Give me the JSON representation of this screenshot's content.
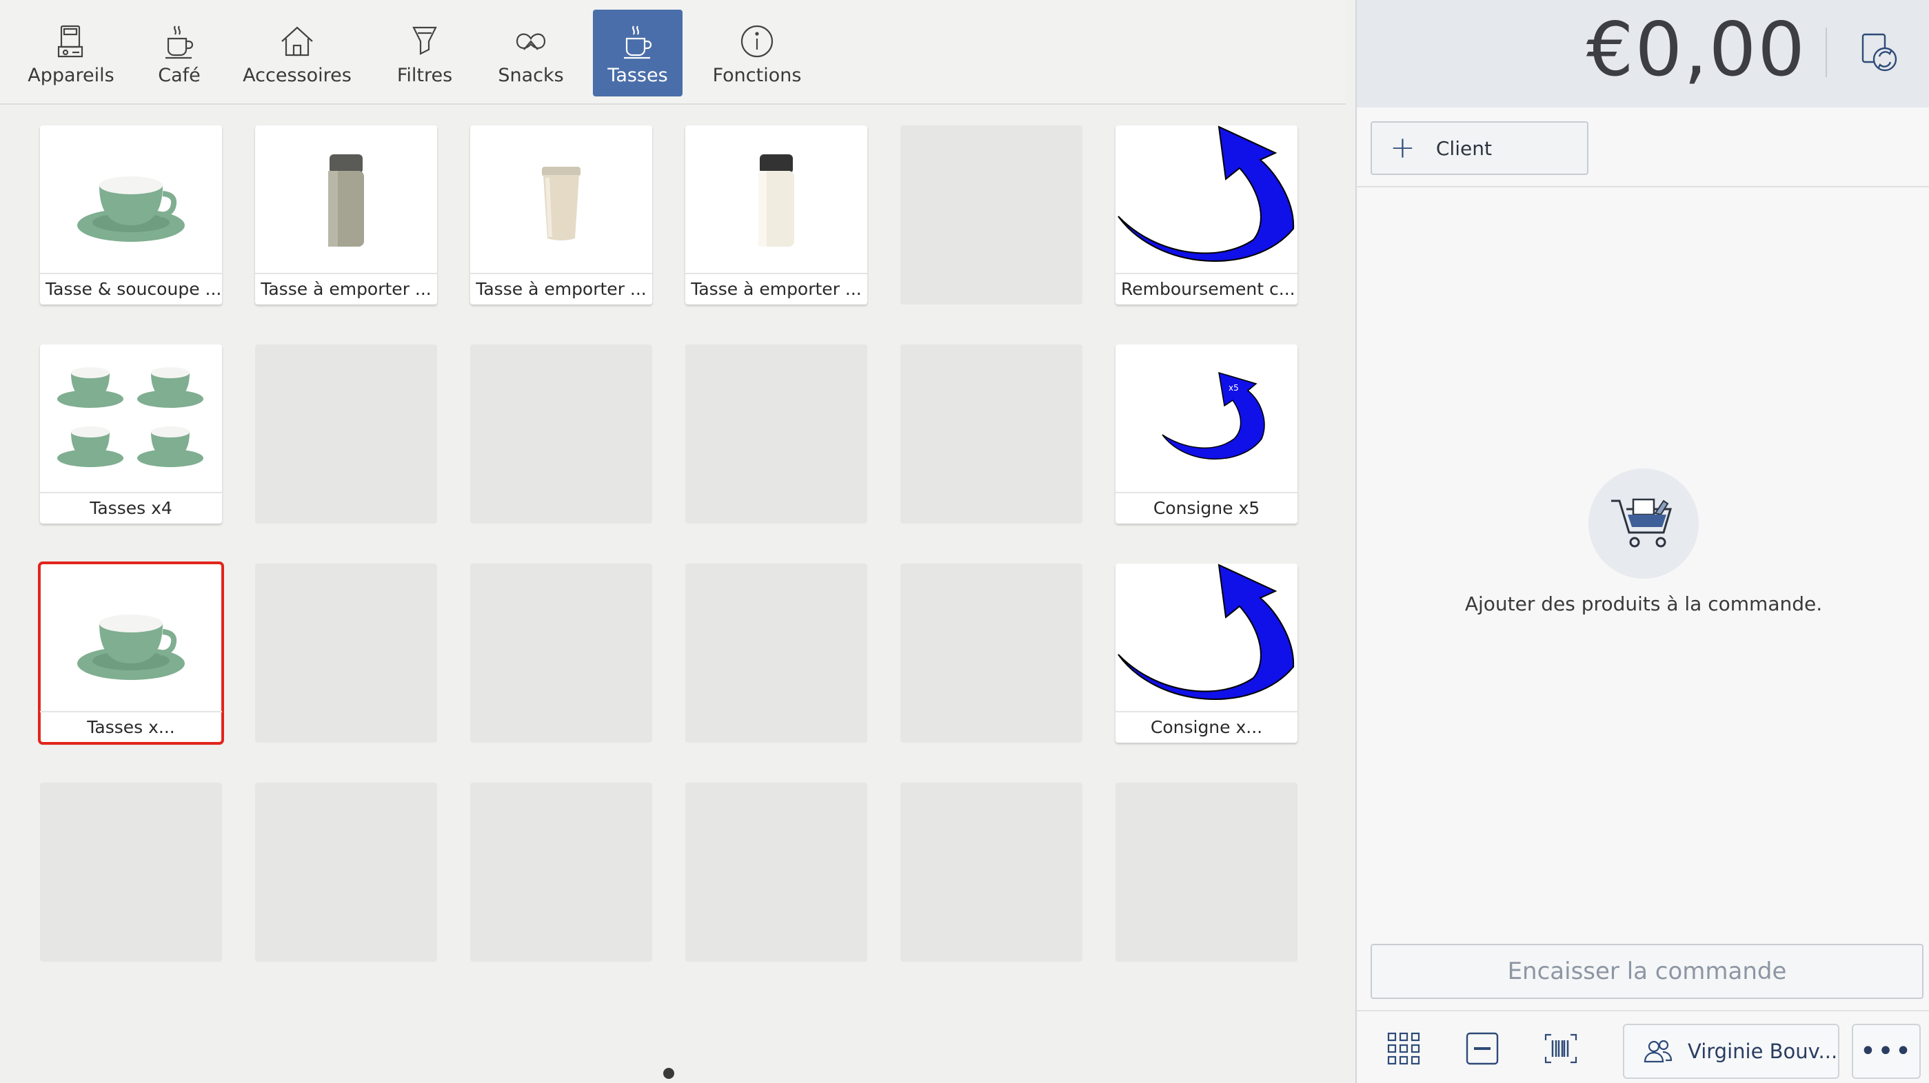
{
  "tabs": [
    {
      "label": "Appareils",
      "icon": "device-icon"
    },
    {
      "label": "Café",
      "icon": "coffee-cup-icon"
    },
    {
      "label": "Accessoires",
      "icon": "house-icon"
    },
    {
      "label": "Filtres",
      "icon": "filter-icon"
    },
    {
      "label": "Snacks",
      "icon": "pretzel-icon"
    },
    {
      "label": "Tasses",
      "icon": "coffee-cup-icon",
      "active": true
    },
    {
      "label": "Fonctions",
      "icon": "info-icon"
    }
  ],
  "products": [
    {
      "label": "Tasse & soucoupe ...",
      "image": "cup-saucer"
    },
    {
      "label": "Tasse à emporter ...",
      "image": "bottle-khaki"
    },
    {
      "label": "Tasse à emporter ...",
      "image": "tumbler-cream"
    },
    {
      "label": "Tasse à emporter ...",
      "image": "bottle-cream"
    },
    {
      "label": "Remboursement c...",
      "image": "blue-arrow"
    },
    {
      "label": "Tasses x4",
      "image": "cups-x4"
    },
    {
      "label": "Consigne x5",
      "image": "blue-arrow-small",
      "arrow_text": "x5"
    },
    {
      "label": "Tasses x...",
      "image": "cup-saucer",
      "selected": true
    },
    {
      "label": "Consigne x...",
      "image": "blue-arrow"
    }
  ],
  "order": {
    "total": "€0,00",
    "client_label": "Client",
    "empty_message": "Ajouter des produits à la commande.",
    "checkout_label": "Encaisser la commande",
    "user_name": "Virginie Bouv...",
    "more_label": "•••"
  },
  "colors": {
    "accent": "#4a6ea9",
    "selection": "#e1251b",
    "cup_green": "#7fae90",
    "arrow_blue": "#1010e8"
  }
}
